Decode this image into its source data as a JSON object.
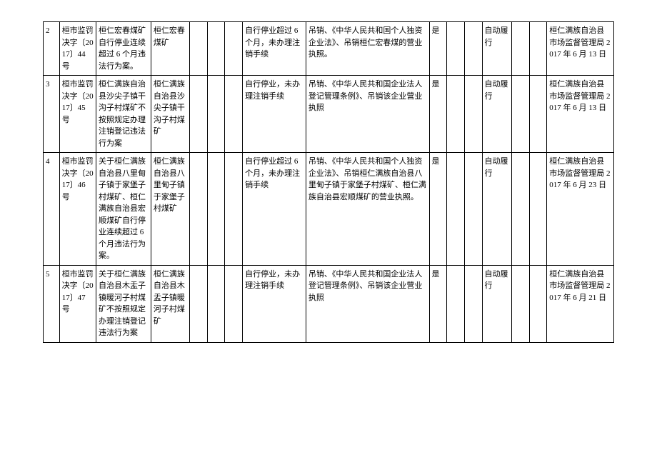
{
  "rows": [
    {
      "index": "2",
      "doc_no": "桓市监罚决字〔2017〕44 号",
      "case_name": "桓仁宏春煤矿自行停业连续超过 6 个月违法行为案。",
      "party": "桓仁宏春煤矿",
      "violation": "自行停业超过 6 个月，未办理注销手续",
      "penalty": "吊销、《中华人民共和国个人独资企业法》、吊销桓仁宏春煤的营业执照。",
      "yes_flag": "是",
      "performance": "自动履行",
      "authority": "桓仁满族自治县市场监督管理局 2017 年 6 月 13 日"
    },
    {
      "index": "3",
      "doc_no": "桓市监罚决字〔2017〕45 号",
      "case_name": "桓仁满族自治县沙尖子镇干沟子村煤矿不按照规定办理注销登记违法行为案",
      "party": "桓仁满族自治县沙尖子镇干沟子村煤矿",
      "violation": "自行停业，未办理注销手续",
      "penalty": "吊销、《中华人民共和国企业法人登记管理条例》、吊销该企业营业执照",
      "yes_flag": "是",
      "performance": "自动履行",
      "authority": "桓仁满族自治县市场监督管理局 2017 年 6 月 13 日"
    },
    {
      "index": "4",
      "doc_no": "桓市监罚决字〔2017〕46 号",
      "case_name": "关于桓仁满族自治县八里甸子镇于家堡子村煤矿、桓仁满族自治县宏顺煤矿自行停业连续超过 6 个月违法行为案。",
      "party": "桓仁满族自治县八里甸子镇于家堡子村煤矿",
      "violation": "自行停业超过 6 个月，未办理注销手续",
      "penalty": "吊销、《中华人民共和国个人独资企业法》、吊销桓仁满族自治县八里甸子镇于家堡子村煤矿、桓仁满族自治县宏顺煤矿的营业执照。",
      "yes_flag": "是",
      "performance": "自动履行",
      "authority": "桓仁满族自治县市场监督管理局 2017 年 6 月 23 日"
    },
    {
      "index": "5",
      "doc_no": "桓市监罚决字〔2017〕47 号",
      "case_name": "关于桓仁满族自治县木盂子镇暖河子村煤矿不按照规定办理注销登记违法行为案",
      "party": "桓仁满族自治县木盂子镇暖河子村煤矿",
      "violation": "自行停业，未办理注销手续",
      "penalty": "吊销、《中华人民共和国企业法人登记管理条例》、吊销该企业营业执照",
      "yes_flag": "是",
      "performance": "自动履行",
      "authority": "桓仁满族自治县市场监督管理局 2017 年 6 月 21 日"
    }
  ]
}
